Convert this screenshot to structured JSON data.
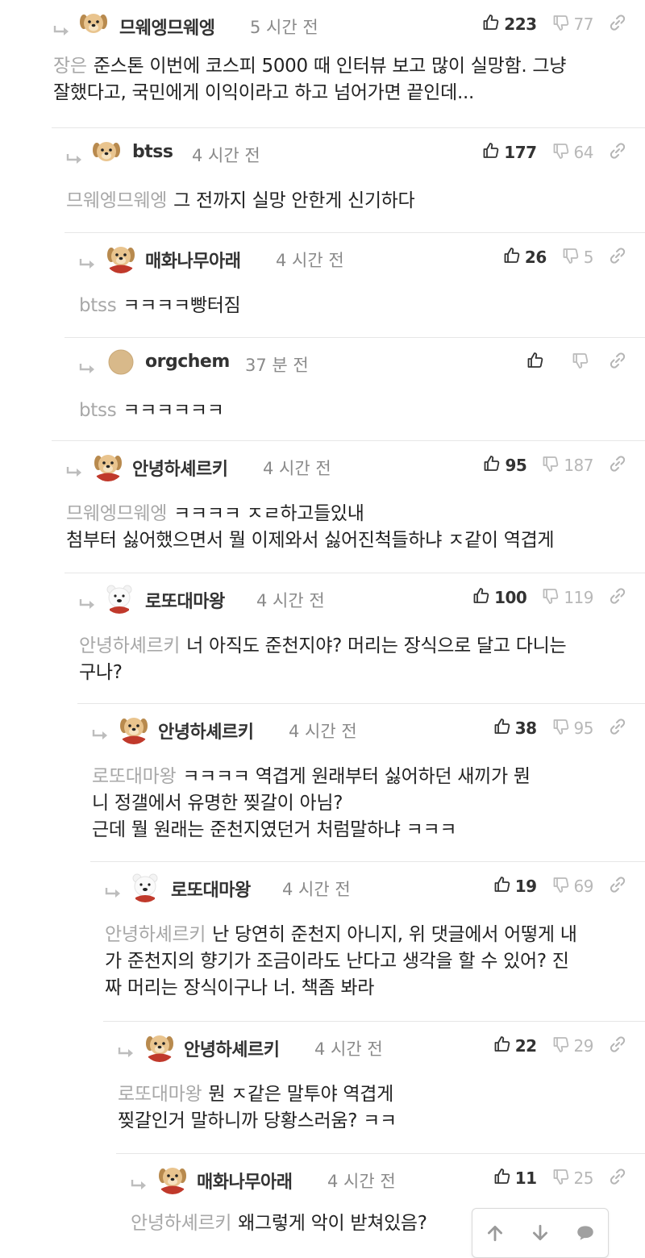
{
  "icons": {
    "reply": "reply-arrow-icon",
    "upvote": "thumbs-up-icon",
    "downvote": "thumbs-down-icon",
    "link": "link-icon",
    "scroll_up": "arrow-up-icon",
    "scroll_down": "arrow-down-icon",
    "comment": "speech-bubble-icon"
  },
  "colors": {
    "mention": "#a8a8a8",
    "time": "#8a8a8a",
    "divider": "#e6e6e6",
    "down_count": "#b8b8b8"
  },
  "comments": [
    {
      "nick": "므웨엥므웨엥",
      "time": "5 시간 전",
      "up": "223",
      "down": "77",
      "mention": "장은",
      "lines": [
        "준스톤 이번에 코스피 5000 때 인터뷰 보고 많이 실망함. 그냥",
        "잘했다고, 국민에게 이익이라고 하고 넘어가면 끝인데..."
      ],
      "avatar": "puppy"
    },
    {
      "nick": "btss",
      "time": "4 시간 전",
      "up": "177",
      "down": "64",
      "mention": "므웨엥므웨엥",
      "lines": [
        "그 전까지 실망 안한게 신기하다"
      ],
      "avatar": "puppy"
    },
    {
      "nick": "매화나무아래",
      "time": "4 시간 전",
      "up": "26",
      "down": "5",
      "mention": "btss",
      "lines": [
        "ㅋㅋㅋㅋ빵터짐"
      ],
      "avatar": "puppy-cape"
    },
    {
      "nick": "orgchem",
      "time": "37 분 전",
      "up": "",
      "down": "",
      "mention": "btss",
      "lines": [
        "ㅋㅋㅋㅋㅋㅋ"
      ],
      "avatar": "circle"
    },
    {
      "nick": "안녕하셰르키",
      "time": "4 시간 전",
      "up": "95",
      "down": "187",
      "mention": "므웨엥므웨엥",
      "lines": [
        "ㅋㅋㅋㅋ ㅈㄹ하고들있내",
        "첨부터 싫어했으면서 뭘 이제와서 싫어진척들하냐 ㅈ같이 역겹게"
      ],
      "avatar": "puppy-cape"
    },
    {
      "nick": "로또대마왕",
      "time": "4 시간 전",
      "up": "100",
      "down": "119",
      "mention": "안녕하셰르키",
      "lines": [
        "너 아직도 준천지야? 머리는 장식으로 달고 다니는",
        "구나?"
      ],
      "avatar": "bear"
    },
    {
      "nick": "안녕하셰르키",
      "time": "4 시간 전",
      "up": "38",
      "down": "95",
      "mention": "로또대마왕",
      "lines": [
        "ㅋㅋㅋㅋ 역겹게 원래부터 싫어하던 새끼가 뭔",
        "니 정갤에서 유명한 찢갈이 아님?",
        "근데 뭘 원래는 준천지였던거 처럼말하냐 ㅋㅋㅋ"
      ],
      "avatar": "puppy-cape"
    },
    {
      "nick": "로또대마왕",
      "time": "4 시간 전",
      "up": "19",
      "down": "69",
      "mention": "안녕하셰르키",
      "lines": [
        "난 당연히 준천지 아니지, 위 댓글에서 어떻게 내",
        "가 준천지의 향기가 조금이라도 난다고 생각을 할 수 있어? 진",
        "짜 머리는 장식이구나 너. 책좀 봐라"
      ],
      "avatar": "bear"
    },
    {
      "nick": "안녕하셰르키",
      "time": "4 시간 전",
      "up": "22",
      "down": "29",
      "mention": "로또대마왕",
      "lines": [
        "뭔 ㅈ같은 말투야 역겹게",
        "찢갈인거 말하니까 당황스러움? ㅋㅋ"
      ],
      "avatar": "puppy-cape"
    },
    {
      "nick": "매화나무아래",
      "time": "4 시간 전",
      "up": "11",
      "down": "25",
      "mention": "안녕하셰르키",
      "lines": [
        "왜그렇게 악이 받쳐있음?"
      ],
      "avatar": "puppy-cape"
    }
  ]
}
